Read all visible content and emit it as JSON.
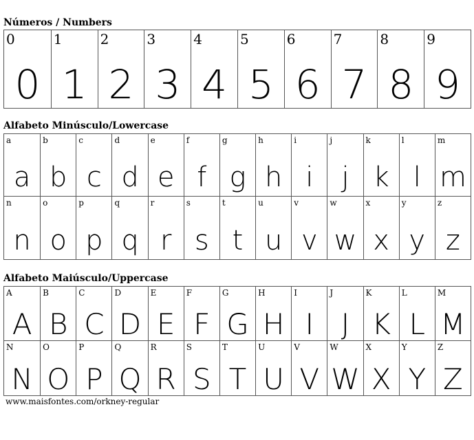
{
  "numbers": {
    "title": "Números / Numbers",
    "items": [
      "0",
      "1",
      "2",
      "3",
      "4",
      "5",
      "6",
      "7",
      "8",
      "9"
    ]
  },
  "lowercase": {
    "title": "Alfabeto Minúsculo/Lowercase",
    "items": [
      "a",
      "b",
      "c",
      "d",
      "e",
      "f",
      "g",
      "h",
      "i",
      "j",
      "k",
      "l",
      "m",
      "n",
      "o",
      "p",
      "q",
      "r",
      "s",
      "t",
      "u",
      "v",
      "w",
      "x",
      "y",
      "z"
    ]
  },
  "uppercase": {
    "title": "Alfabeto Maiúsculo/Uppercase",
    "items": [
      "A",
      "B",
      "C",
      "D",
      "E",
      "F",
      "G",
      "H",
      "I",
      "J",
      "K",
      "L",
      "M",
      "N",
      "O",
      "P",
      "Q",
      "R",
      "S",
      "T",
      "U",
      "V",
      "W",
      "X",
      "Y",
      "Z"
    ]
  },
  "footer": {
    "url": "www.maisfontes.com/orkney-regular"
  }
}
